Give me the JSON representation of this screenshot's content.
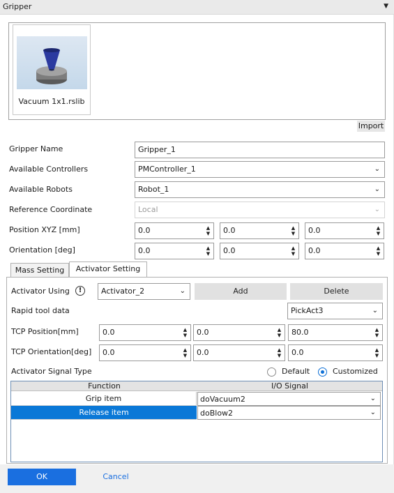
{
  "panel": {
    "title": "Gripper"
  },
  "library": {
    "items": [
      {
        "label": "Vacuum 1x1.rslib",
        "icon": "vacuum-gripper-thumbnail"
      }
    ],
    "import_label": "Import"
  },
  "form": {
    "gripper_name": {
      "label": "Gripper Name",
      "value": "Gripper_1"
    },
    "available_controllers": {
      "label": "Available Controllers",
      "value": "PMController_1"
    },
    "available_robots": {
      "label": "Available Robots",
      "value": "Robot_1"
    },
    "reference_coordinate": {
      "label": "Reference Coordinate",
      "value": "Local"
    },
    "position_xyz": {
      "label": "Position XYZ [mm]",
      "x": "0.0",
      "y": "0.0",
      "z": "0.0"
    },
    "orientation": {
      "label": "Orientation [deg]",
      "x": "0.0",
      "y": "0.0",
      "z": "0.0"
    }
  },
  "tabs": [
    {
      "label": "Mass Setting",
      "active": false
    },
    {
      "label": "Activator Setting",
      "active": true
    }
  ],
  "activator": {
    "using_label": "Activator Using",
    "using_value": "Activator_2",
    "add_label": "Add",
    "delete_label": "Delete",
    "rapid_label": "Rapid tool data",
    "rapid_value": "PickAct3",
    "tcp_position": {
      "label": "TCP Position[mm]",
      "x": "0.0",
      "y": "0.0",
      "z": "80.0"
    },
    "tcp_orientation": {
      "label": "TCP Orientation[deg]",
      "x": "0.0",
      "y": "0.0",
      "z": "0.0"
    },
    "signal_type_label": "Activator Signal Type",
    "signal_options": {
      "default": "Default",
      "customized": "Customized",
      "selected": "Customized"
    }
  },
  "signal_table": {
    "columns": [
      "Function",
      "I/O Signal"
    ],
    "rows": [
      {
        "function": "Grip item",
        "signal": "doVacuum2",
        "selected": false
      },
      {
        "function": "Release item",
        "signal": "doBlow2",
        "selected": true
      }
    ]
  },
  "footer": {
    "ok_label": "OK",
    "cancel_label": "Cancel"
  },
  "colors": {
    "accent": "#1a6fe0",
    "selection": "#0a78d7"
  }
}
